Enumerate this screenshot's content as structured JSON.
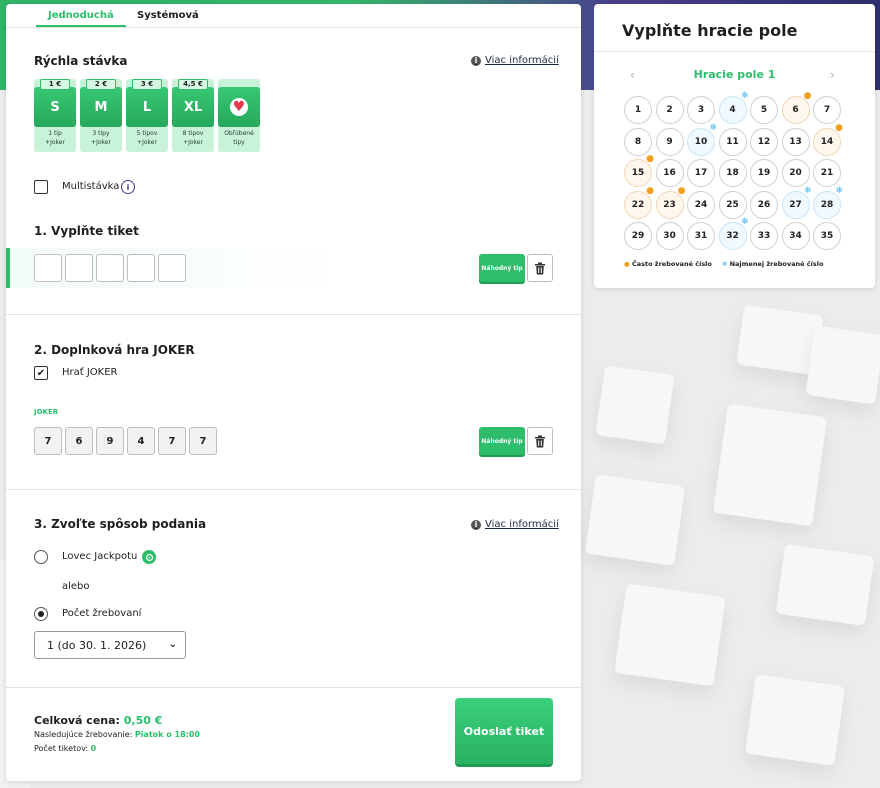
{
  "tabs": [
    "Jednoduchá",
    "Systémová"
  ],
  "quick_bet": {
    "title": "Rýchla stávka",
    "info_link": "Viac informácií",
    "options": [
      {
        "price": "1 €",
        "label": "S",
        "desc1": "1 tip",
        "desc2": "+Joker"
      },
      {
        "price": "2 €",
        "label": "M",
        "desc1": "3 tipy",
        "desc2": "+Joker"
      },
      {
        "price": "3 €",
        "label": "L",
        "desc1": "5 tipov",
        "desc2": "+Joker"
      },
      {
        "price": "4,5 €",
        "label": "XL",
        "desc1": "8 tipov",
        "desc2": "+Joker"
      },
      {
        "price": "",
        "label": "",
        "desc1": "Obľúbené",
        "desc2": "tipy"
      }
    ]
  },
  "multibet": {
    "label": "Multistávka",
    "badge": "i"
  },
  "ticket": {
    "title": "1. Vyplňte tiket",
    "random_label": "Náhodný tip",
    "numbers": [
      "",
      "",
      "",
      "",
      ""
    ]
  },
  "joker": {
    "title": "2. Doplnková hra JOKER",
    "play_label": "Hrať JOKER",
    "section_label": "JOKER",
    "numbers": [
      "7",
      "6",
      "9",
      "4",
      "7",
      "7"
    ],
    "random_label": "Náhodný tip"
  },
  "submission": {
    "title": "3. Zvoľte spôsob podania",
    "info_link": "Viac informácií",
    "option1": "Lovec Jackpotu",
    "or_text": "alebo",
    "option2": "Počet žrebovaní",
    "select_value": "1 (do 30. 1. 2026)"
  },
  "footer": {
    "total_label": "Celková cena:",
    "total_value": "0,50 €",
    "next_draw_label": "Nasledujúce žrebovanie:",
    "next_draw_value": "Piatok o 18:00",
    "ticket_count_label": "Počet tiketov:",
    "ticket_count_value": "0",
    "submit_label": "Odoslať tiket"
  },
  "side": {
    "title": "Vyplňte hracie pole",
    "field_title": "Hracie pole 1",
    "prev": "‹",
    "next": "›",
    "numbers": [
      {
        "n": "1",
        "t": ""
      },
      {
        "n": "2",
        "t": ""
      },
      {
        "n": "3",
        "t": ""
      },
      {
        "n": "4",
        "t": "cold"
      },
      {
        "n": "5",
        "t": ""
      },
      {
        "n": "6",
        "t": "hot"
      },
      {
        "n": "7",
        "t": ""
      },
      {
        "n": "8",
        "t": ""
      },
      {
        "n": "9",
        "t": ""
      },
      {
        "n": "10",
        "t": "cold"
      },
      {
        "n": "11",
        "t": ""
      },
      {
        "n": "12",
        "t": ""
      },
      {
        "n": "13",
        "t": ""
      },
      {
        "n": "14",
        "t": "hot"
      },
      {
        "n": "15",
        "t": "hot"
      },
      {
        "n": "16",
        "t": ""
      },
      {
        "n": "17",
        "t": ""
      },
      {
        "n": "18",
        "t": ""
      },
      {
        "n": "19",
        "t": ""
      },
      {
        "n": "20",
        "t": ""
      },
      {
        "n": "21",
        "t": ""
      },
      {
        "n": "22",
        "t": "hot"
      },
      {
        "n": "23",
        "t": "hot"
      },
      {
        "n": "24",
        "t": ""
      },
      {
        "n": "25",
        "t": ""
      },
      {
        "n": "26",
        "t": ""
      },
      {
        "n": "27",
        "t": "cold"
      },
      {
        "n": "28",
        "t": "cold"
      },
      {
        "n": "29",
        "t": ""
      },
      {
        "n": "30",
        "t": ""
      },
      {
        "n": "31",
        "t": ""
      },
      {
        "n": "32",
        "t": "cold"
      },
      {
        "n": "33",
        "t": ""
      },
      {
        "n": "34",
        "t": ""
      },
      {
        "n": "35",
        "t": ""
      }
    ],
    "legend_hot": "Často žrebované číslo",
    "legend_cold": "Najmenej žrebované číslo"
  },
  "colors": {
    "accent": "#2ebd6b",
    "hot": "#f0a020",
    "cold": "#3fb4e8"
  }
}
